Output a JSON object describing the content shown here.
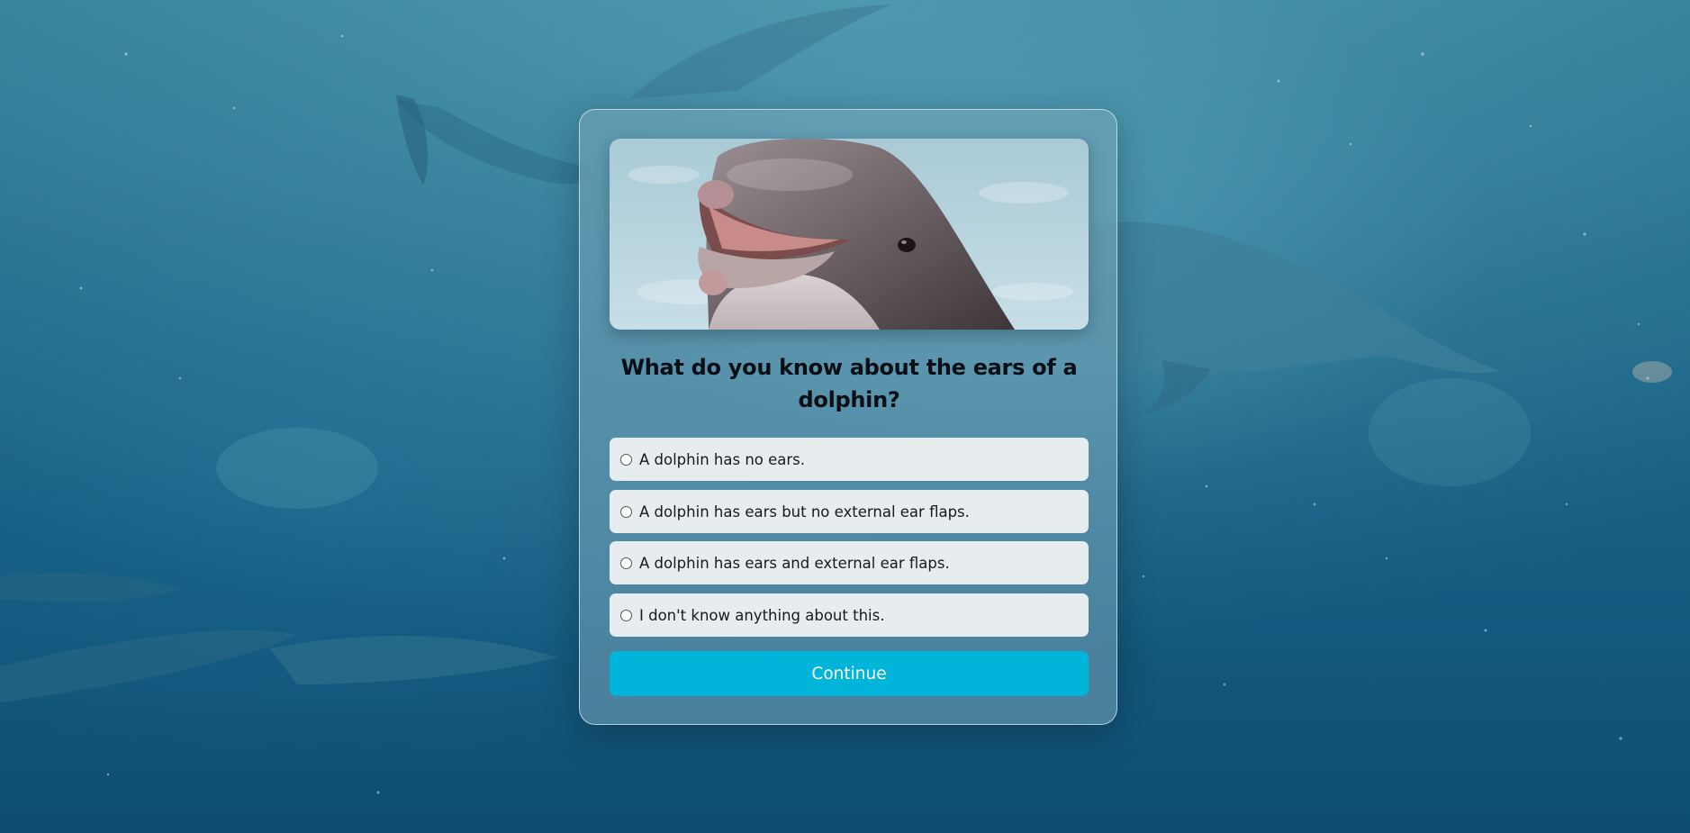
{
  "background": {
    "image": "underwater-dolphins-scene",
    "accent": "#1f6a8b"
  },
  "card": {
    "hero_image": "dolphin-portrait-open-mouth",
    "question": "What do you know about the ears of a dolphin?",
    "options": [
      {
        "label": "A dolphin has no ears.",
        "selected": false
      },
      {
        "label": "A dolphin has ears but no external ear flaps.",
        "selected": false
      },
      {
        "label": "A dolphin has ears and external ear flaps.",
        "selected": false
      },
      {
        "label": "I don't know anything about this.",
        "selected": false
      }
    ],
    "continue_label": "Continue",
    "continue_color": "#00b4da"
  }
}
